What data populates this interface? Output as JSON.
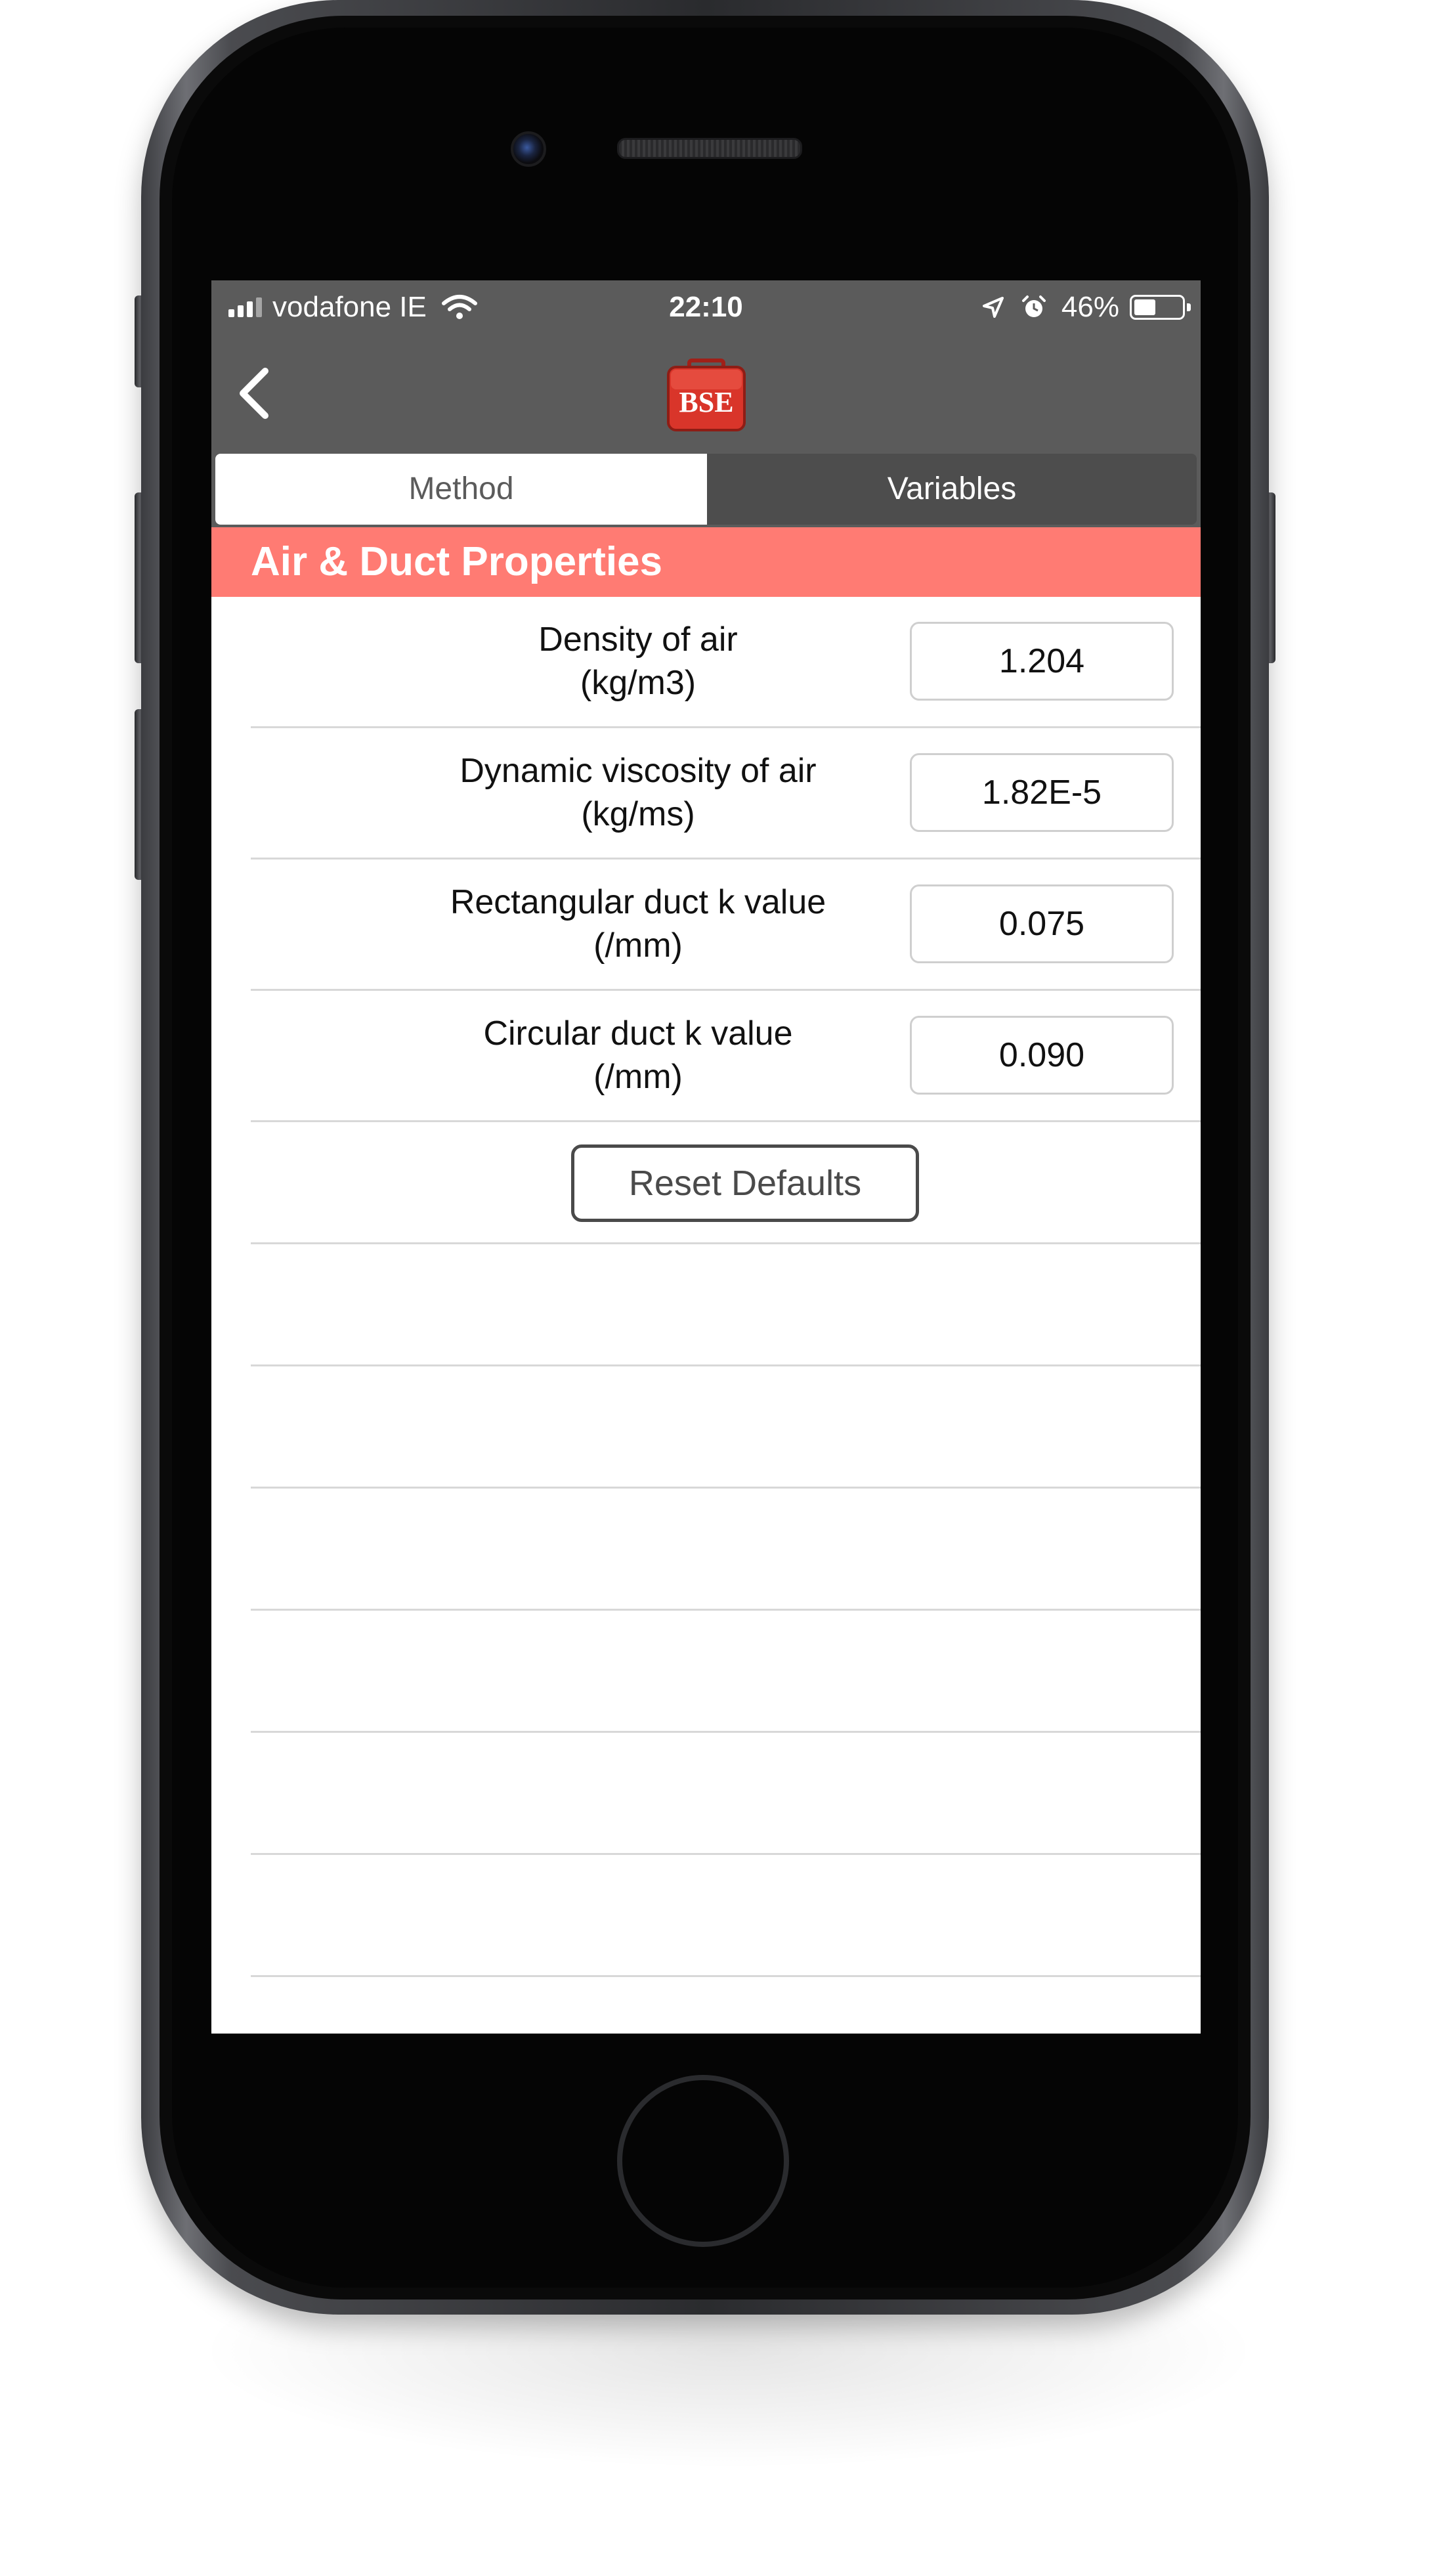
{
  "status_bar": {
    "carrier": "vodafone IE",
    "time": "22:10",
    "battery_percent": "46%",
    "battery_level": 0.46,
    "icons": [
      "signal-icon",
      "wifi-icon",
      "location-icon",
      "alarm-icon",
      "battery-icon"
    ]
  },
  "nav_bar": {
    "back_icon": "chevron-left-icon",
    "logo_text": "BSE"
  },
  "tabs": [
    {
      "label": "Method",
      "selected": true
    },
    {
      "label": "Variables",
      "selected": false
    }
  ],
  "section": {
    "title": "Air & Duct Properties"
  },
  "fields": [
    {
      "label_line1": "Density of air",
      "label_line2": "(kg/m3)",
      "value": "1.204"
    },
    {
      "label_line1": "Dynamic viscosity of air",
      "label_line2": "(kg/ms)",
      "value": "1.82E-5"
    },
    {
      "label_line1": "Rectangular duct k value",
      "label_line2": "(/mm)",
      "value": "0.075"
    },
    {
      "label_line1": "Circular duct k value",
      "label_line2": "(/mm)",
      "value": "0.090"
    }
  ],
  "reset_button": {
    "label": "Reset Defaults"
  },
  "colors": {
    "bar": "#5b5b5b",
    "section_header": "#ff7b73",
    "logo_red": "#d9352a"
  }
}
